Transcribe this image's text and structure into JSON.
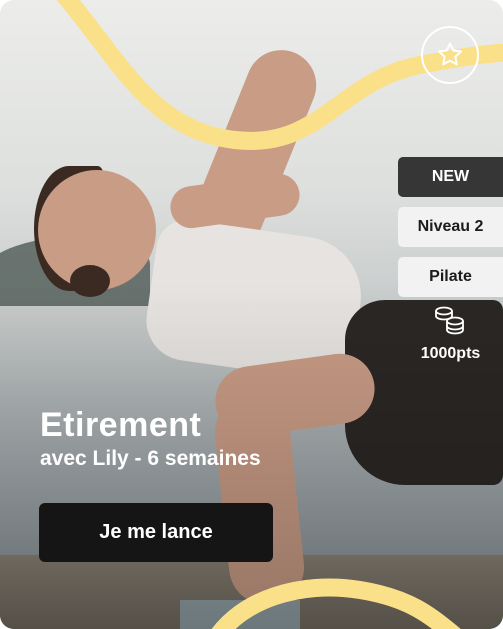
{
  "card": {
    "favorite_icon": "star-outline-icon",
    "badges": {
      "status": "NEW",
      "level": "Niveau 2",
      "category": "Pilate"
    },
    "reward": {
      "icon": "coins-icon",
      "points": "1000pts"
    },
    "program": {
      "title": "Etirement",
      "subtitle": "avec Lily - 6 semaines"
    },
    "cta_label": "Je me lance"
  },
  "colors": {
    "wave": "#fbe08a",
    "button_bg": "#151515",
    "badge_dark": "#363636",
    "badge_light": "#f2f2f2"
  }
}
